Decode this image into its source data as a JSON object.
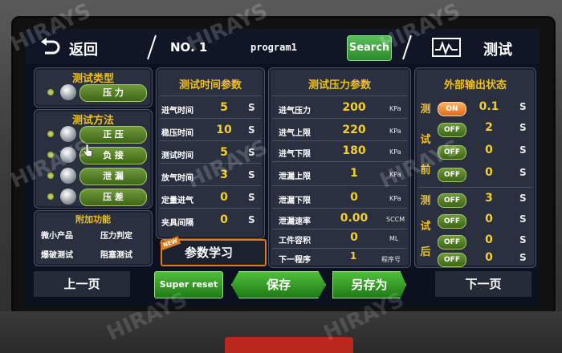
{
  "topbar": {
    "back_label": "返回",
    "program_no": "NO. 1",
    "program_name": "program1",
    "search_label": "Search",
    "test_label": "测试"
  },
  "test_type": {
    "title": "测试类型",
    "selected": "压 力"
  },
  "test_method": {
    "title": "测试方法",
    "items": [
      "正 压",
      "负 接",
      "泄 漏",
      "压 差"
    ]
  },
  "extra_functions": {
    "title": "附加功能",
    "items": [
      "微小产品",
      "压力判定",
      "爆破测试",
      "阻塞测试"
    ]
  },
  "time_params": {
    "title": "测试时间参数",
    "rows": [
      {
        "label": "进气时间",
        "value": "5",
        "unit": "S"
      },
      {
        "label": "稳压时间",
        "value": "10",
        "unit": "S"
      },
      {
        "label": "测试时间",
        "value": "5",
        "unit": "S"
      },
      {
        "label": "放气时间",
        "value": "3",
        "unit": "S"
      },
      {
        "label": "定量进气",
        "value": "0",
        "unit": "S"
      },
      {
        "label": "夹具间隔",
        "value": "0",
        "unit": "S"
      }
    ],
    "learn_badge": "NEW",
    "learn_label": "参数学习"
  },
  "pressure_params": {
    "title": "测试压力参数",
    "rows": [
      {
        "label": "进气压力",
        "value": "200",
        "unit": "KPa"
      },
      {
        "label": "进气上限",
        "value": "220",
        "unit": "KPa"
      },
      {
        "label": "进气下限",
        "value": "180",
        "unit": "KPa"
      },
      {
        "label": "泄漏上限",
        "value": "1",
        "unit": "KPa"
      },
      {
        "label": "泄漏下限",
        "value": "0",
        "unit": "KPa"
      },
      {
        "label": "泄漏速率",
        "value": "0.00",
        "unit": "SCCM"
      },
      {
        "label": "工件容积",
        "value": "0",
        "unit": "ML"
      },
      {
        "label": "下一程序",
        "value": "1",
        "unit": "程序号"
      }
    ]
  },
  "external_output": {
    "title": "外部输出状态",
    "before_label": [
      "测",
      "试",
      "前"
    ],
    "after_label": [
      "测",
      "试",
      "后"
    ],
    "before": [
      {
        "state": "ON",
        "value": "0.1",
        "unit": "S"
      },
      {
        "state": "OFF",
        "value": "2",
        "unit": "S"
      },
      {
        "state": "OFF",
        "value": "0",
        "unit": "S"
      },
      {
        "state": "OFF",
        "value": "0",
        "unit": "S"
      }
    ],
    "after": [
      {
        "state": "OFF",
        "value": "3",
        "unit": "S"
      },
      {
        "state": "OFF",
        "value": "0",
        "unit": "S"
      },
      {
        "state": "OFF",
        "value": "0",
        "unit": "S"
      },
      {
        "state": "OFF",
        "value": "0",
        "unit": "S"
      }
    ]
  },
  "bottombar": {
    "prev_label": "上一页",
    "super_reset_label": "Super reset",
    "save_label": "保存",
    "save_as_label": "另存为",
    "next_label": "下一页"
  },
  "watermark": "HIRAYS",
  "colors": {
    "accent_yellow": "#f4cf2a",
    "button_green": "#3d9a2a",
    "on_orange": "#e06a1a"
  }
}
